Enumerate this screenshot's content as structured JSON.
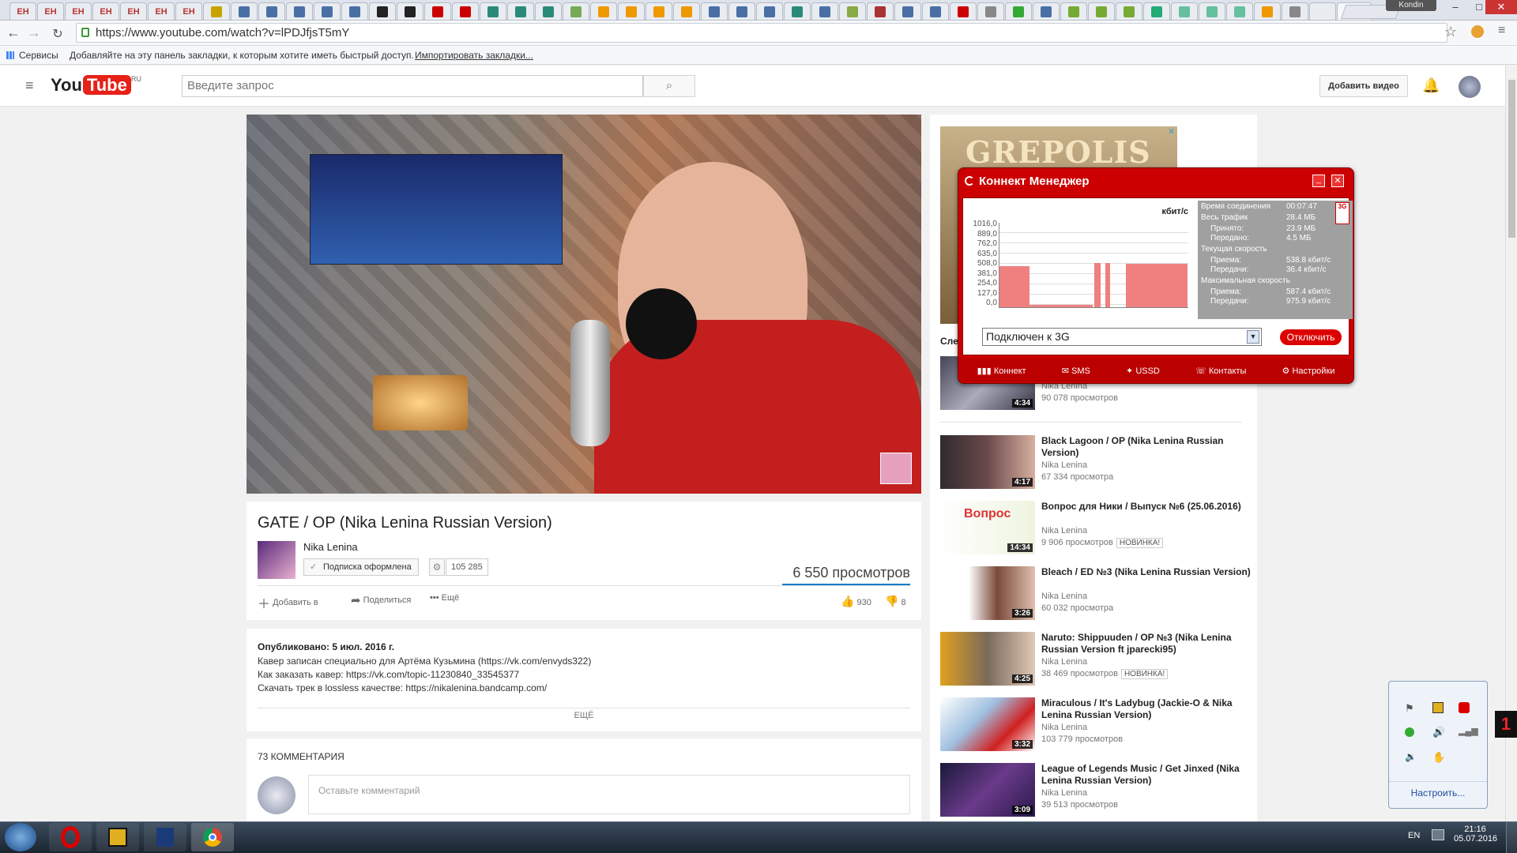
{
  "browser": {
    "tabs": [
      "EH",
      "EH",
      "EH",
      "EH",
      "EH",
      "EH",
      "EH",
      "",
      "",
      "",
      "",
      "",
      "",
      "",
      "",
      "",
      "",
      "",
      "",
      "",
      "",
      "",
      "",
      "",
      "",
      "",
      "",
      "",
      "",
      "",
      "",
      "",
      "",
      "",
      "",
      "",
      "",
      "",
      "",
      "",
      "",
      "",
      "",
      "",
      "",
      "",
      "",
      "",
      ""
    ],
    "tab_colors": [
      "#b33",
      "#b33",
      "#b33",
      "#b33",
      "#b33",
      "#b33",
      "#b33",
      "#c8a300",
      "#4a6fa5",
      "#4a6fa5",
      "#4a6fa5",
      "#4a6fa5",
      "#4a6fa5",
      "#222",
      "#222",
      "#c00",
      "#c00",
      "#2a8a7a",
      "#2a8a7a",
      "#2a8a7a",
      "#7a5",
      "#e90",
      "#e90",
      "#e90",
      "#e90",
      "#4a6fa5",
      "#4a6fa5",
      "#4a6fa5",
      "#2a8a7a",
      "#4a6fa5",
      "#8a4",
      "#a33",
      "#4a6fa5",
      "#4a6fa5",
      "#c00",
      "#888",
      "#3a3",
      "#4a6fa5",
      "#7a3",
      "#7a3",
      "#7a3",
      "#2a7",
      "#2a7a",
      "#2a7a",
      "#2a7a",
      "#e90",
      "#888"
    ],
    "user_chip": "Kondin",
    "url": "https://www.youtube.com/watch?v=lPDJfjsT5mY",
    "bookmarks": {
      "apps_label": "Сервисы",
      "hint": "Добавляйте на эту панель закладки, к которым хотите иметь быстрый доступ.",
      "import_link": "Импортировать закладки..."
    }
  },
  "youtube": {
    "logo_you": "You",
    "logo_tube": "Tube",
    "logo_region": "RU",
    "search_placeholder": "Введите запрос",
    "upload_label": "Добавить видео",
    "video": {
      "title": "GATE / OP (Nika Lenina Russian Version)",
      "channel": "Nika Lenina",
      "subscribe_label": "Подписка оформлена",
      "subscribers": "105 285",
      "views": "6 550 просмотров",
      "add_label": "Добавить в",
      "share_label": "Поделиться",
      "more_label": "Ещё",
      "likes": "930",
      "dislikes": "8"
    },
    "description": {
      "published": "Опубликовано: 5 июл. 2016 г.",
      "lines": [
        "Кавер записан специально для Артёма Кузьмина (https://vk.com/envyds322)",
        "Как заказать кавер: https://vk.com/topic-11230840_33545377",
        "Скачать трек в lossless качестве: https://nikalenina.bandcamp.com/"
      ],
      "more": "ЕЩЁ"
    },
    "comments": {
      "count_label": "73 КОММЕНТАРИЯ",
      "placeholder": "Оставьте комментарий"
    },
    "ad_text": "GREPOLIS",
    "up_next_label": "Сле",
    "recommended": [
      {
        "title": "",
        "channel": "Nika Lenina",
        "views": "90 078 просмотров",
        "duration": "4:34",
        "badge": ""
      },
      {
        "title": "Black Lagoon / OP (Nika Lenina Russian Version)",
        "channel": "Nika Lenina",
        "views": "67 334 просмотра",
        "duration": "4:17",
        "badge": ""
      },
      {
        "title": "Вопрос для Ники / Выпуск №6 (25.06.2016)",
        "channel": "Nika Lenina",
        "views": "9 906 просмотров",
        "duration": "14:34",
        "badge": "НОВИНКА!"
      },
      {
        "title": "Bleach / ED №3 (Nika Lenina Russian Version)",
        "channel": "Nika Lenina",
        "views": "60 032 просмотра",
        "duration": "3:26",
        "badge": ""
      },
      {
        "title": "Naruto: Shippuuden / OP №3 (Nika Lenina Russian Version ft jparecki95)",
        "channel": "Nika Lenina",
        "views": "38 469 просмотров",
        "duration": "4:25",
        "badge": "НОВИНКА!"
      },
      {
        "title": "Miraculous / It's Ladybug (Jackie-O & Nika Lenina Russian Version)",
        "channel": "Nika Lenina",
        "views": "103 779 просмотров",
        "duration": "3:32",
        "badge": ""
      },
      {
        "title": "League of Legends Music / Get Jinxed (Nika Lenina Russian Version)",
        "channel": "Nika Lenina",
        "views": "39 513 просмотров",
        "duration": "3:09",
        "badge": ""
      }
    ]
  },
  "connect_manager": {
    "title": "Коннект Менеджер",
    "unit": "кбит/с",
    "y_ticks": [
      "1016,0",
      "889,0",
      "762,0",
      "635,0",
      "508,0",
      "381,0",
      "254,0",
      "127,0",
      "0,0"
    ],
    "stats": [
      {
        "label": "Время соединения",
        "value": "00:07:47"
      },
      {
        "label": "Весь трафик",
        "value": "28.4 МБ"
      },
      {
        "label": "Принято:",
        "value": "23.9 МБ"
      },
      {
        "label": "Передано:",
        "value": "4.5 МБ"
      },
      {
        "label": "Текущая скорость",
        "value": ""
      },
      {
        "label": "Приема:",
        "value": "538.8 кбит/с"
      },
      {
        "label": "Передачи:",
        "value": "36.4 кбит/с"
      },
      {
        "label": "Максимальная скорость",
        "value": ""
      },
      {
        "label": "Приема:",
        "value": "587.4 кбит/с"
      },
      {
        "label": "Передачи:",
        "value": "975.9 кбит/с"
      }
    ],
    "network_badge": "3G",
    "status": "Подключен к 3G",
    "disconnect_label": "Отключить",
    "nav": [
      "Коннект",
      "SMS",
      "USSD",
      "Контакты",
      "Настройки"
    ]
  },
  "tray": {
    "configure_label": "Настроить..."
  },
  "taskbar": {
    "lang": "EN",
    "time": "21:16",
    "date": "05.07.2016",
    "notification_count": "1"
  }
}
